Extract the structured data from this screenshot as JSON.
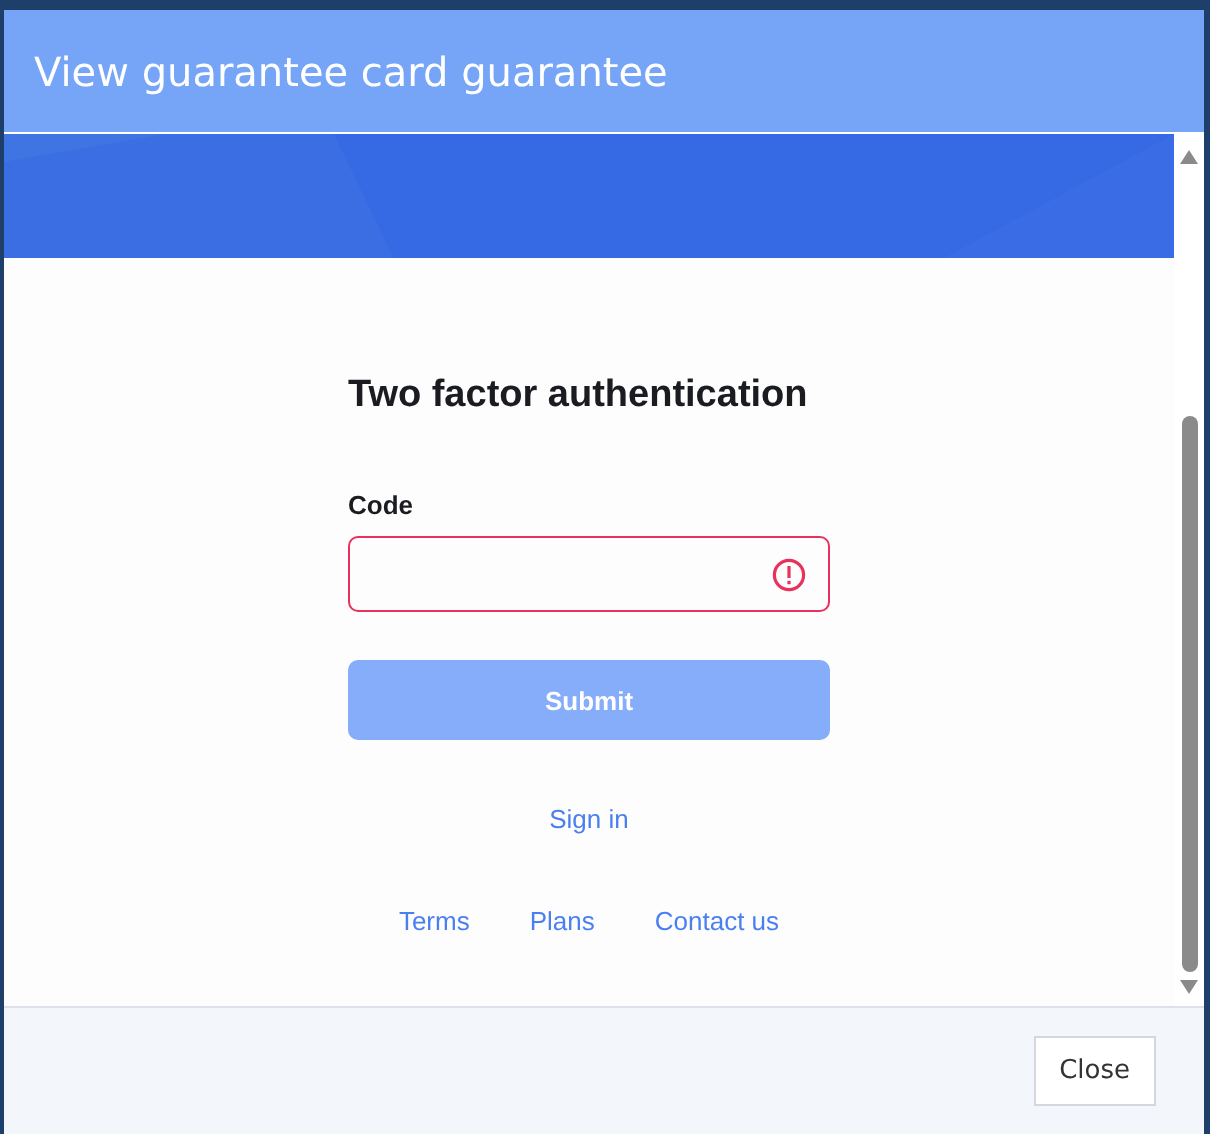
{
  "dialog": {
    "title": "View guarantee card guarantee"
  },
  "form": {
    "heading": "Two factor authentication",
    "field": {
      "label": "Code",
      "error": true
    },
    "submit": {
      "label": "Submit",
      "disabled": true
    },
    "sign_in": "Sign in",
    "footer_links": [
      "Terms",
      "Plans",
      "Contact us"
    ]
  },
  "buttons": [
    "Close"
  ]
}
